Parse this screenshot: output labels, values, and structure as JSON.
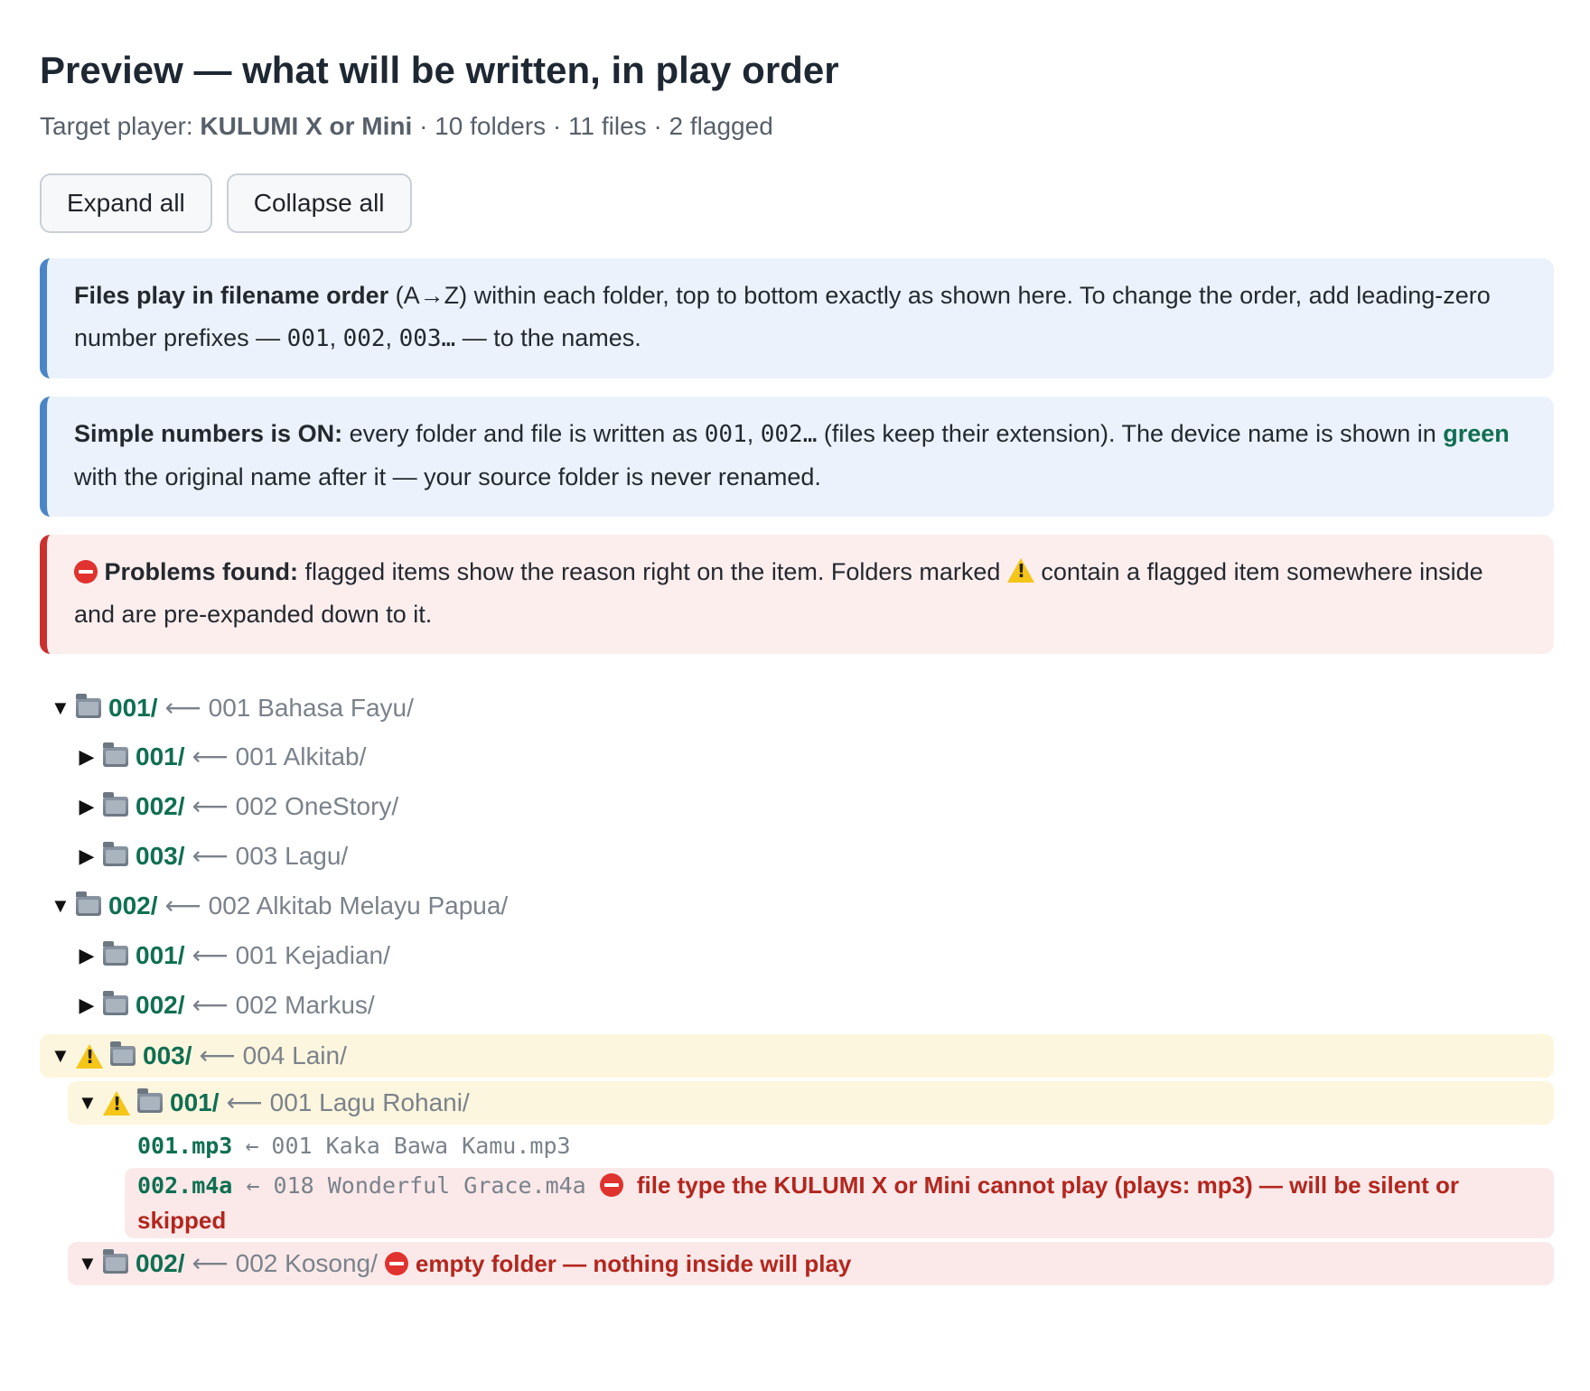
{
  "header": {
    "title": "Preview — what will be written, in play order",
    "target_prefix": "Target player: ",
    "player": "KULUMI X or Mini",
    "summary": " · 10 folders · 11 files · 2 flagged"
  },
  "toolbar": {
    "expand_label": "Expand all",
    "collapse_label": "Collapse all"
  },
  "notes": {
    "order": {
      "bold": "Files play in filename order",
      "t1": " (A→Z) within each folder, top to bottom exactly as shown here. To change the order, add leading-zero number prefixes — ",
      "c1": "001",
      "s1": ", ",
      "c2": "002",
      "s2": ", ",
      "c3": "003…",
      "t2": " — to the names."
    },
    "simple": {
      "bold": "Simple numbers is ON:",
      "t1": " every folder and file is written as ",
      "c1": "001",
      "s1": ", ",
      "c2": "002…",
      "t2": " (files keep their extension). The device name is shown in ",
      "green": "green",
      "t3": " with the original name after it — your source folder is never renamed."
    },
    "problems": {
      "bold": "Problems found:",
      "t1": " flagged items show the reason right on the item. Folders marked ",
      "t2": " contain a flagged item somewhere inside and are pre-expanded down to it."
    }
  },
  "tree": {
    "arrow": "⟵",
    "arrow_short": "←",
    "r1": {
      "dev": "001/",
      "orig": "001 Bahasa Fayu/"
    },
    "r2": {
      "dev": "001/",
      "orig": "001 Alkitab/"
    },
    "r3": {
      "dev": "002/",
      "orig": "002 OneStory/"
    },
    "r4": {
      "dev": "003/",
      "orig": "003 Lagu/"
    },
    "r5": {
      "dev": "002/",
      "orig": "002 Alkitab Melayu Papua/"
    },
    "r6": {
      "dev": "001/",
      "orig": "001 Kejadian/"
    },
    "r7": {
      "dev": "002/",
      "orig": "002 Markus/"
    },
    "r8": {
      "dev": "003/",
      "orig": "004 Lain/"
    },
    "r9": {
      "dev": "001/",
      "orig": "001 Lagu Rohani/"
    },
    "f1": {
      "dev": "001.mp3",
      "orig": "001 Kaka Bawa Kamu.mp3"
    },
    "f2": {
      "dev": "002.m4a",
      "orig": "018 Wonderful Grace.m4a",
      "error": "file type the KULUMI X or Mini cannot play (plays: mp3) — will be silent or skipped"
    },
    "r10": {
      "dev": "002/",
      "orig": "002 Kosong/",
      "error": "empty folder — nothing inside will play"
    }
  },
  "icons": {
    "expanded": "▼",
    "collapsed": "▶",
    "folder": "folder-icon",
    "warn": "warning-icon",
    "stop": "stop-icon"
  },
  "colors": {
    "device_name": "#0f6f52",
    "error": "#b3261e",
    "info_border": "#4a86c7",
    "error_border": "#c9312f"
  }
}
